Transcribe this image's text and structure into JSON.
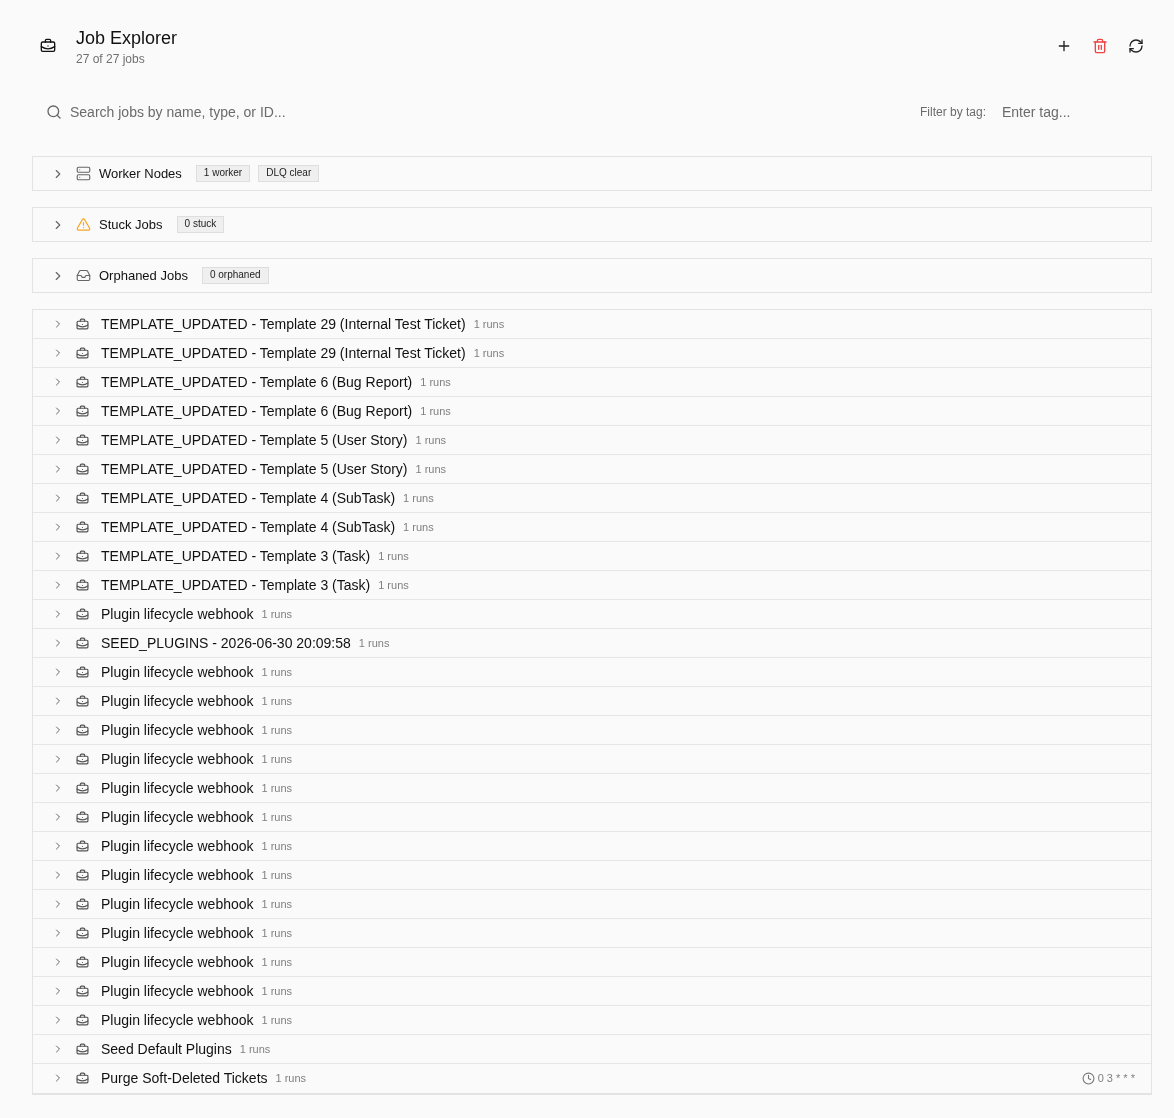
{
  "header": {
    "title": "Job Explorer",
    "subtitle": "27 of 27 jobs"
  },
  "search": {
    "placeholder": "Search jobs by name, type, or ID..."
  },
  "tag_filter": {
    "label": "Filter by tag:",
    "placeholder": "Enter tag..."
  },
  "sections": [
    {
      "kind": "workers",
      "title": "Worker Nodes",
      "expanded": false,
      "badges": [
        "1 worker",
        "DLQ clear"
      ]
    },
    {
      "kind": "stuck",
      "title": "Stuck Jobs",
      "expanded": false,
      "badges": [
        "0 stuck"
      ]
    },
    {
      "kind": "orphaned",
      "title": "Orphaned Jobs",
      "expanded": false,
      "badges": [
        "0 orphaned"
      ]
    }
  ],
  "jobs": [
    {
      "name": "TEMPLATE_UPDATED - Template 29 (Internal Test Ticket)",
      "runs": "1 runs",
      "expanded": false
    },
    {
      "name": "TEMPLATE_UPDATED - Template 29 (Internal Test Ticket)",
      "runs": "1 runs",
      "expanded": false
    },
    {
      "name": "TEMPLATE_UPDATED - Template 6 (Bug Report)",
      "runs": "1 runs",
      "expanded": false
    },
    {
      "name": "TEMPLATE_UPDATED - Template 6 (Bug Report)",
      "runs": "1 runs",
      "expanded": false
    },
    {
      "name": "TEMPLATE_UPDATED - Template 5 (User Story)",
      "runs": "1 runs",
      "expanded": false
    },
    {
      "name": "TEMPLATE_UPDATED - Template 5 (User Story)",
      "runs": "1 runs",
      "expanded": false
    },
    {
      "name": "TEMPLATE_UPDATED - Template 4 (SubTask)",
      "runs": "1 runs",
      "expanded": false
    },
    {
      "name": "TEMPLATE_UPDATED - Template 4 (SubTask)",
      "runs": "1 runs",
      "expanded": false
    },
    {
      "name": "TEMPLATE_UPDATED - Template 3 (Task)",
      "runs": "1 runs",
      "expanded": false
    },
    {
      "name": "TEMPLATE_UPDATED - Template 3 (Task)",
      "runs": "1 runs",
      "expanded": false
    },
    {
      "name": "Plugin lifecycle webhook",
      "runs": "1 runs",
      "expanded": false
    },
    {
      "name": "SEED_PLUGINS - 2026-06-30 20:09:58",
      "runs": "1 runs",
      "expanded": false
    },
    {
      "name": "Plugin lifecycle webhook",
      "runs": "1 runs",
      "expanded": false
    },
    {
      "name": "Plugin lifecycle webhook",
      "runs": "1 runs",
      "expanded": false
    },
    {
      "name": "Plugin lifecycle webhook",
      "runs": "1 runs",
      "expanded": false
    },
    {
      "name": "Plugin lifecycle webhook",
      "runs": "1 runs",
      "expanded": false
    },
    {
      "name": "Plugin lifecycle webhook",
      "runs": "1 runs",
      "expanded": false
    },
    {
      "name": "Plugin lifecycle webhook",
      "runs": "1 runs",
      "expanded": false
    },
    {
      "name": "Plugin lifecycle webhook",
      "runs": "1 runs",
      "expanded": false
    },
    {
      "name": "Plugin lifecycle webhook",
      "runs": "1 runs",
      "expanded": false
    },
    {
      "name": "Plugin lifecycle webhook",
      "runs": "1 runs",
      "expanded": false
    },
    {
      "name": "Plugin lifecycle webhook",
      "runs": "1 runs",
      "expanded": false
    },
    {
      "name": "Plugin lifecycle webhook",
      "runs": "1 runs",
      "expanded": false
    },
    {
      "name": "Plugin lifecycle webhook",
      "runs": "1 runs",
      "expanded": false
    },
    {
      "name": "Plugin lifecycle webhook",
      "runs": "1 runs",
      "expanded": false
    },
    {
      "name": "Seed Default Plugins",
      "runs": "1 runs",
      "expanded": false
    },
    {
      "name": "Purge Soft-Deleted Tickets",
      "runs": "1 runs",
      "expanded": false,
      "schedule": "0 3 * * *"
    }
  ]
}
